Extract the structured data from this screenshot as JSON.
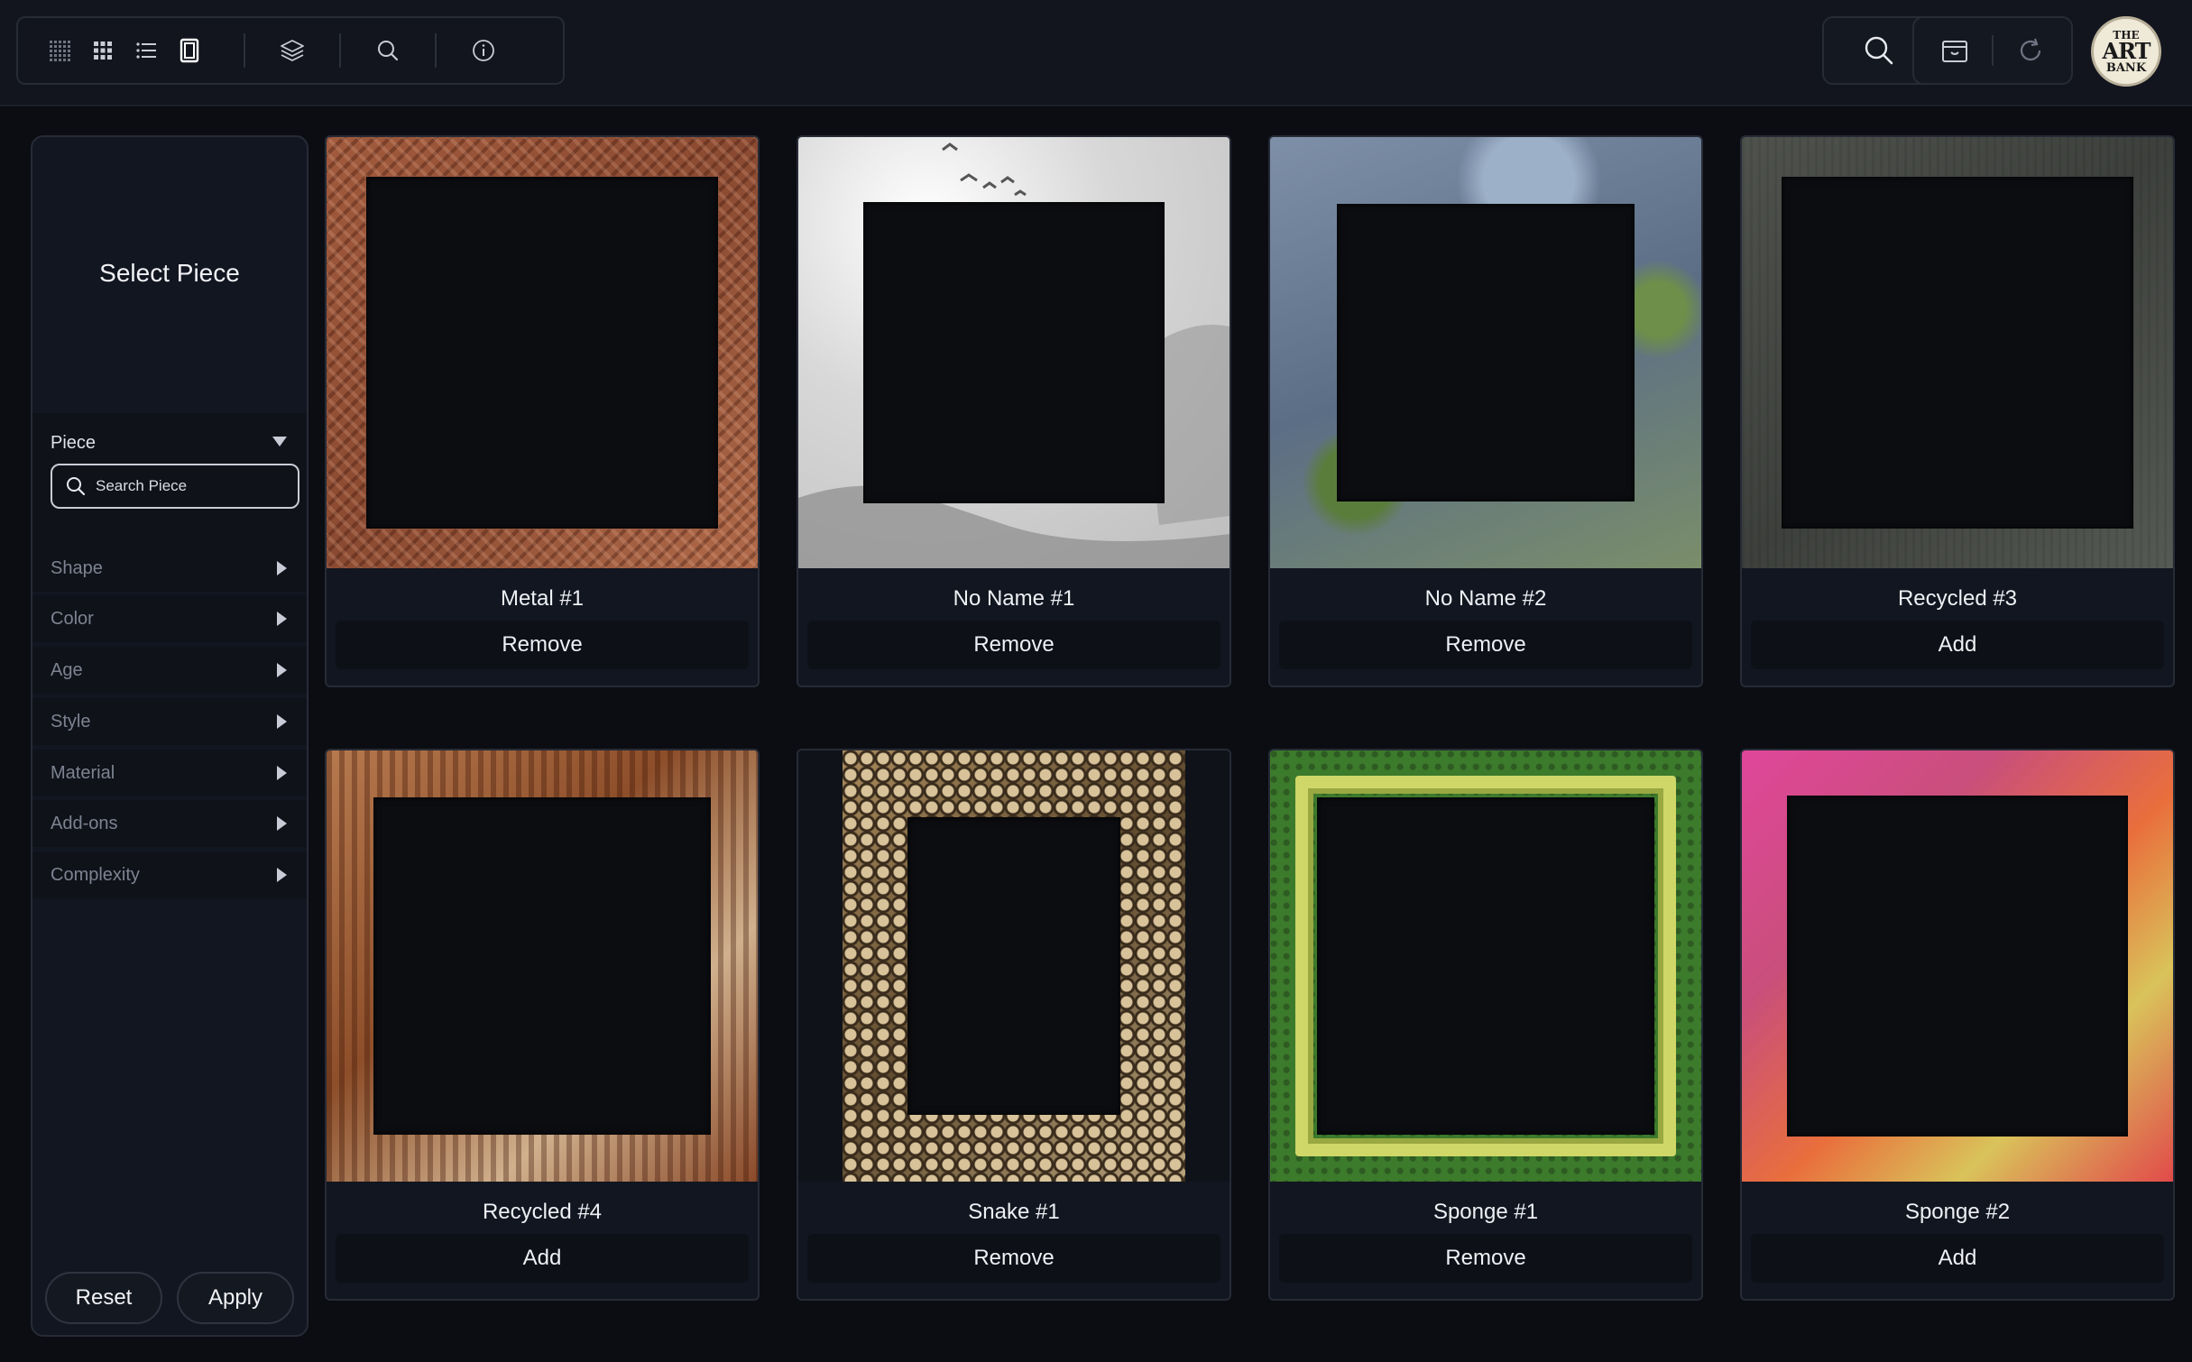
{
  "toolbar": {
    "tools": [
      {
        "icon": "grid-small-icon"
      },
      {
        "icon": "grid-large-icon"
      },
      {
        "icon": "list-icon"
      },
      {
        "icon": "single-view-icon"
      },
      {
        "icon": "layers-icon"
      },
      {
        "icon": "search-icon"
      },
      {
        "icon": "info-icon"
      }
    ]
  },
  "header_right": {
    "search_icon": "search-icon",
    "box_icon": "archive-icon",
    "refresh_icon": "refresh-icon",
    "logo_text": [
      "THE",
      "ART",
      "BANK"
    ]
  },
  "sidebar": {
    "title": "Select Piece",
    "piece_label": "Piece",
    "search_placeholder": "Search Piece",
    "search_value": "",
    "filters": [
      "Shape",
      "Color",
      "Age",
      "Style",
      "Material",
      "Add-ons",
      "Complexity"
    ],
    "reset_label": "Reset",
    "apply_label": "Apply"
  },
  "cards": [
    {
      "name": "Metal #1",
      "action": "Remove"
    },
    {
      "name": "No Name #1",
      "action": "Remove"
    },
    {
      "name": "No Name #2",
      "action": "Remove"
    },
    {
      "name": "Recycled #3",
      "action": "Add"
    },
    {
      "name": "Recycled #4",
      "action": "Add"
    },
    {
      "name": "Snake #1",
      "action": "Remove"
    },
    {
      "name": "Sponge #1",
      "action": "Remove"
    },
    {
      "name": "Sponge #2",
      "action": "Add"
    }
  ],
  "colors": {
    "background": "#0b0d12",
    "panel": "#121620",
    "border": "#262b36",
    "text": "#eef0f4",
    "muted_text": "#7d8391"
  }
}
